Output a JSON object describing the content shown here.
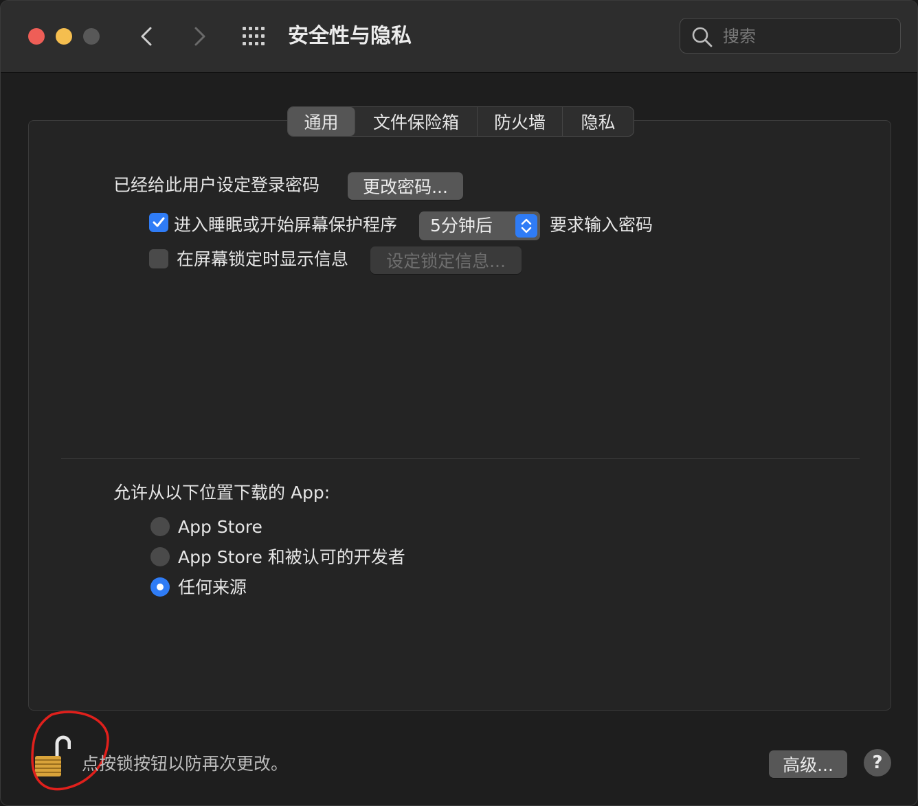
{
  "window": {
    "title": "安全性与隐私",
    "search": {
      "placeholder": "搜索",
      "value": ""
    }
  },
  "tabs": [
    {
      "label": "通用",
      "selected": true
    },
    {
      "label": "文件保险箱",
      "selected": false
    },
    {
      "label": "防火墙",
      "selected": false
    },
    {
      "label": "隐私",
      "selected": false
    }
  ],
  "general": {
    "password_label": "已经给此用户设定登录密码",
    "change_password_button": "更改密码...",
    "require_password": {
      "checked": true,
      "label": "进入睡眠或开始屏幕保护程序",
      "delay_value": "5分钟后",
      "suffix": "要求输入密码"
    },
    "lock_message": {
      "checked": false,
      "label": "在屏幕锁定时显示信息",
      "button": "设定锁定信息..."
    },
    "downloads": {
      "heading": "允许从以下位置下载的 App:",
      "options": [
        {
          "label": "App Store",
          "selected": false
        },
        {
          "label": "App Store 和被认可的开发者",
          "selected": false
        },
        {
          "label": "任何来源",
          "selected": true
        }
      ]
    }
  },
  "footer": {
    "lock_text": "点按锁按钮以防再次更改。",
    "advanced_button": "高级...",
    "help_button": "?"
  },
  "colors": {
    "accent": "#2f7cf6",
    "annotation": "#e0201c",
    "lock_gold": "#d9a33a"
  }
}
